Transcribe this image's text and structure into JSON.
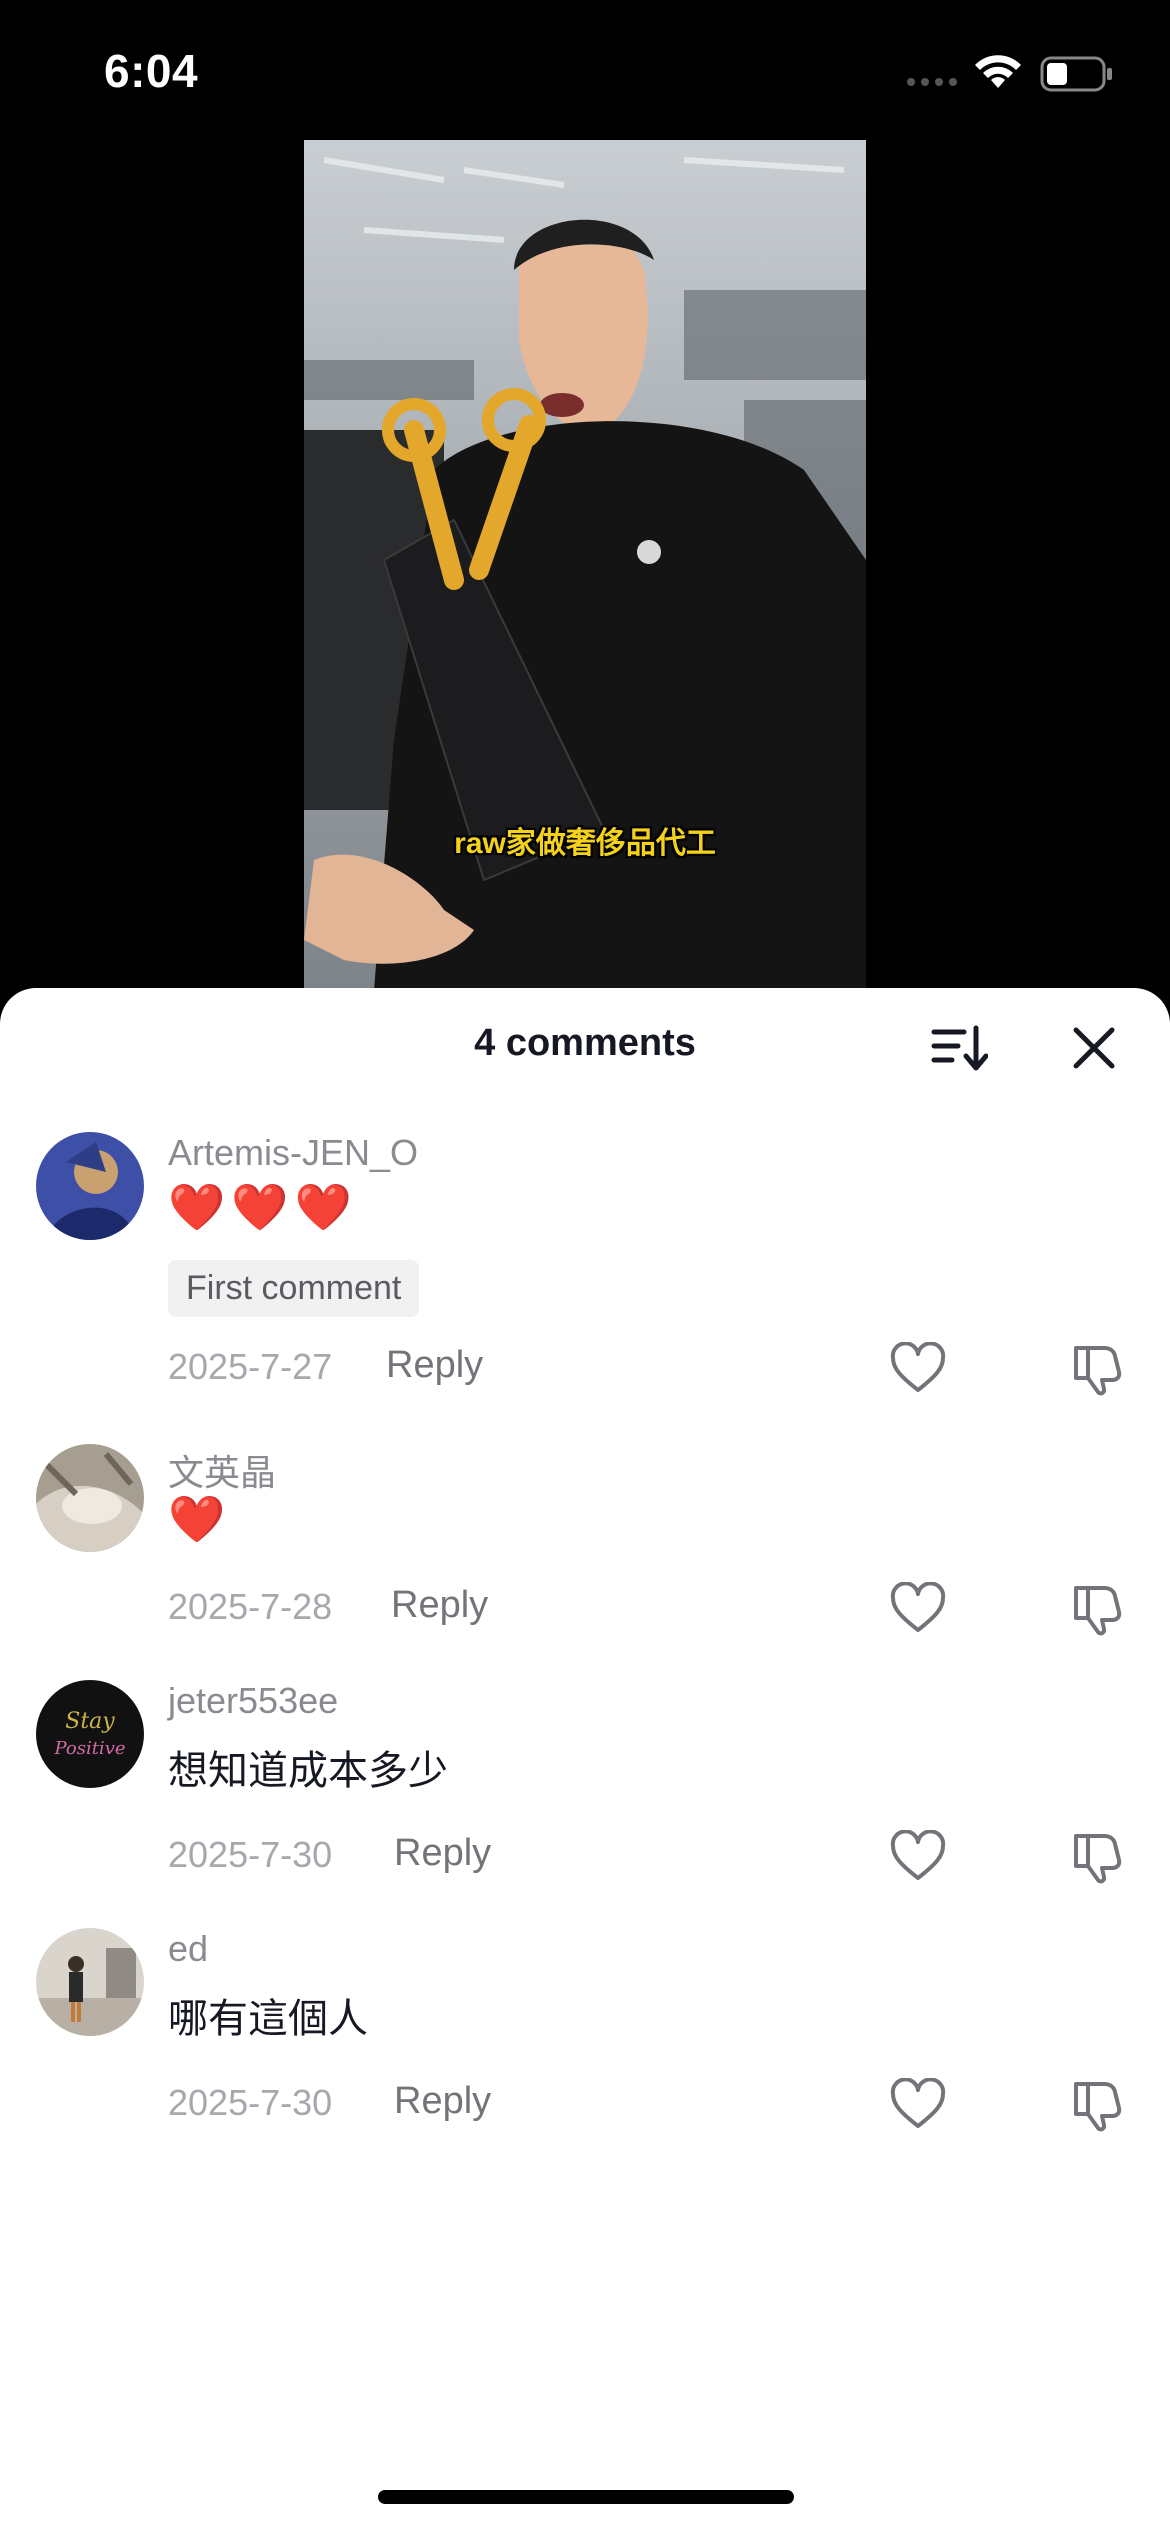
{
  "status_bar": {
    "time": "6:04"
  },
  "video": {
    "caption": "raw家做奢侈品代工"
  },
  "sheet": {
    "title": "4 comments",
    "sort_icon": "sort-icon",
    "close_icon": "close-icon"
  },
  "comments": [
    {
      "username": "Artemis-JEN_O",
      "text": "❤️❤️❤️",
      "tag": "First comment",
      "date": "2025-7-27",
      "reply": "Reply"
    },
    {
      "username": "文英晶",
      "text": "❤️",
      "date": "2025-7-28",
      "reply": "Reply"
    },
    {
      "username": "jeter553ee",
      "text": "想知道成本多少",
      "date": "2025-7-30",
      "reply": "Reply"
    },
    {
      "username": "ed",
      "text": "哪有這個人",
      "date": "2025-7-30",
      "reply": "Reply"
    }
  ],
  "colors": {
    "accent_heart": "#e0202b",
    "caption": "#f5d21a"
  }
}
